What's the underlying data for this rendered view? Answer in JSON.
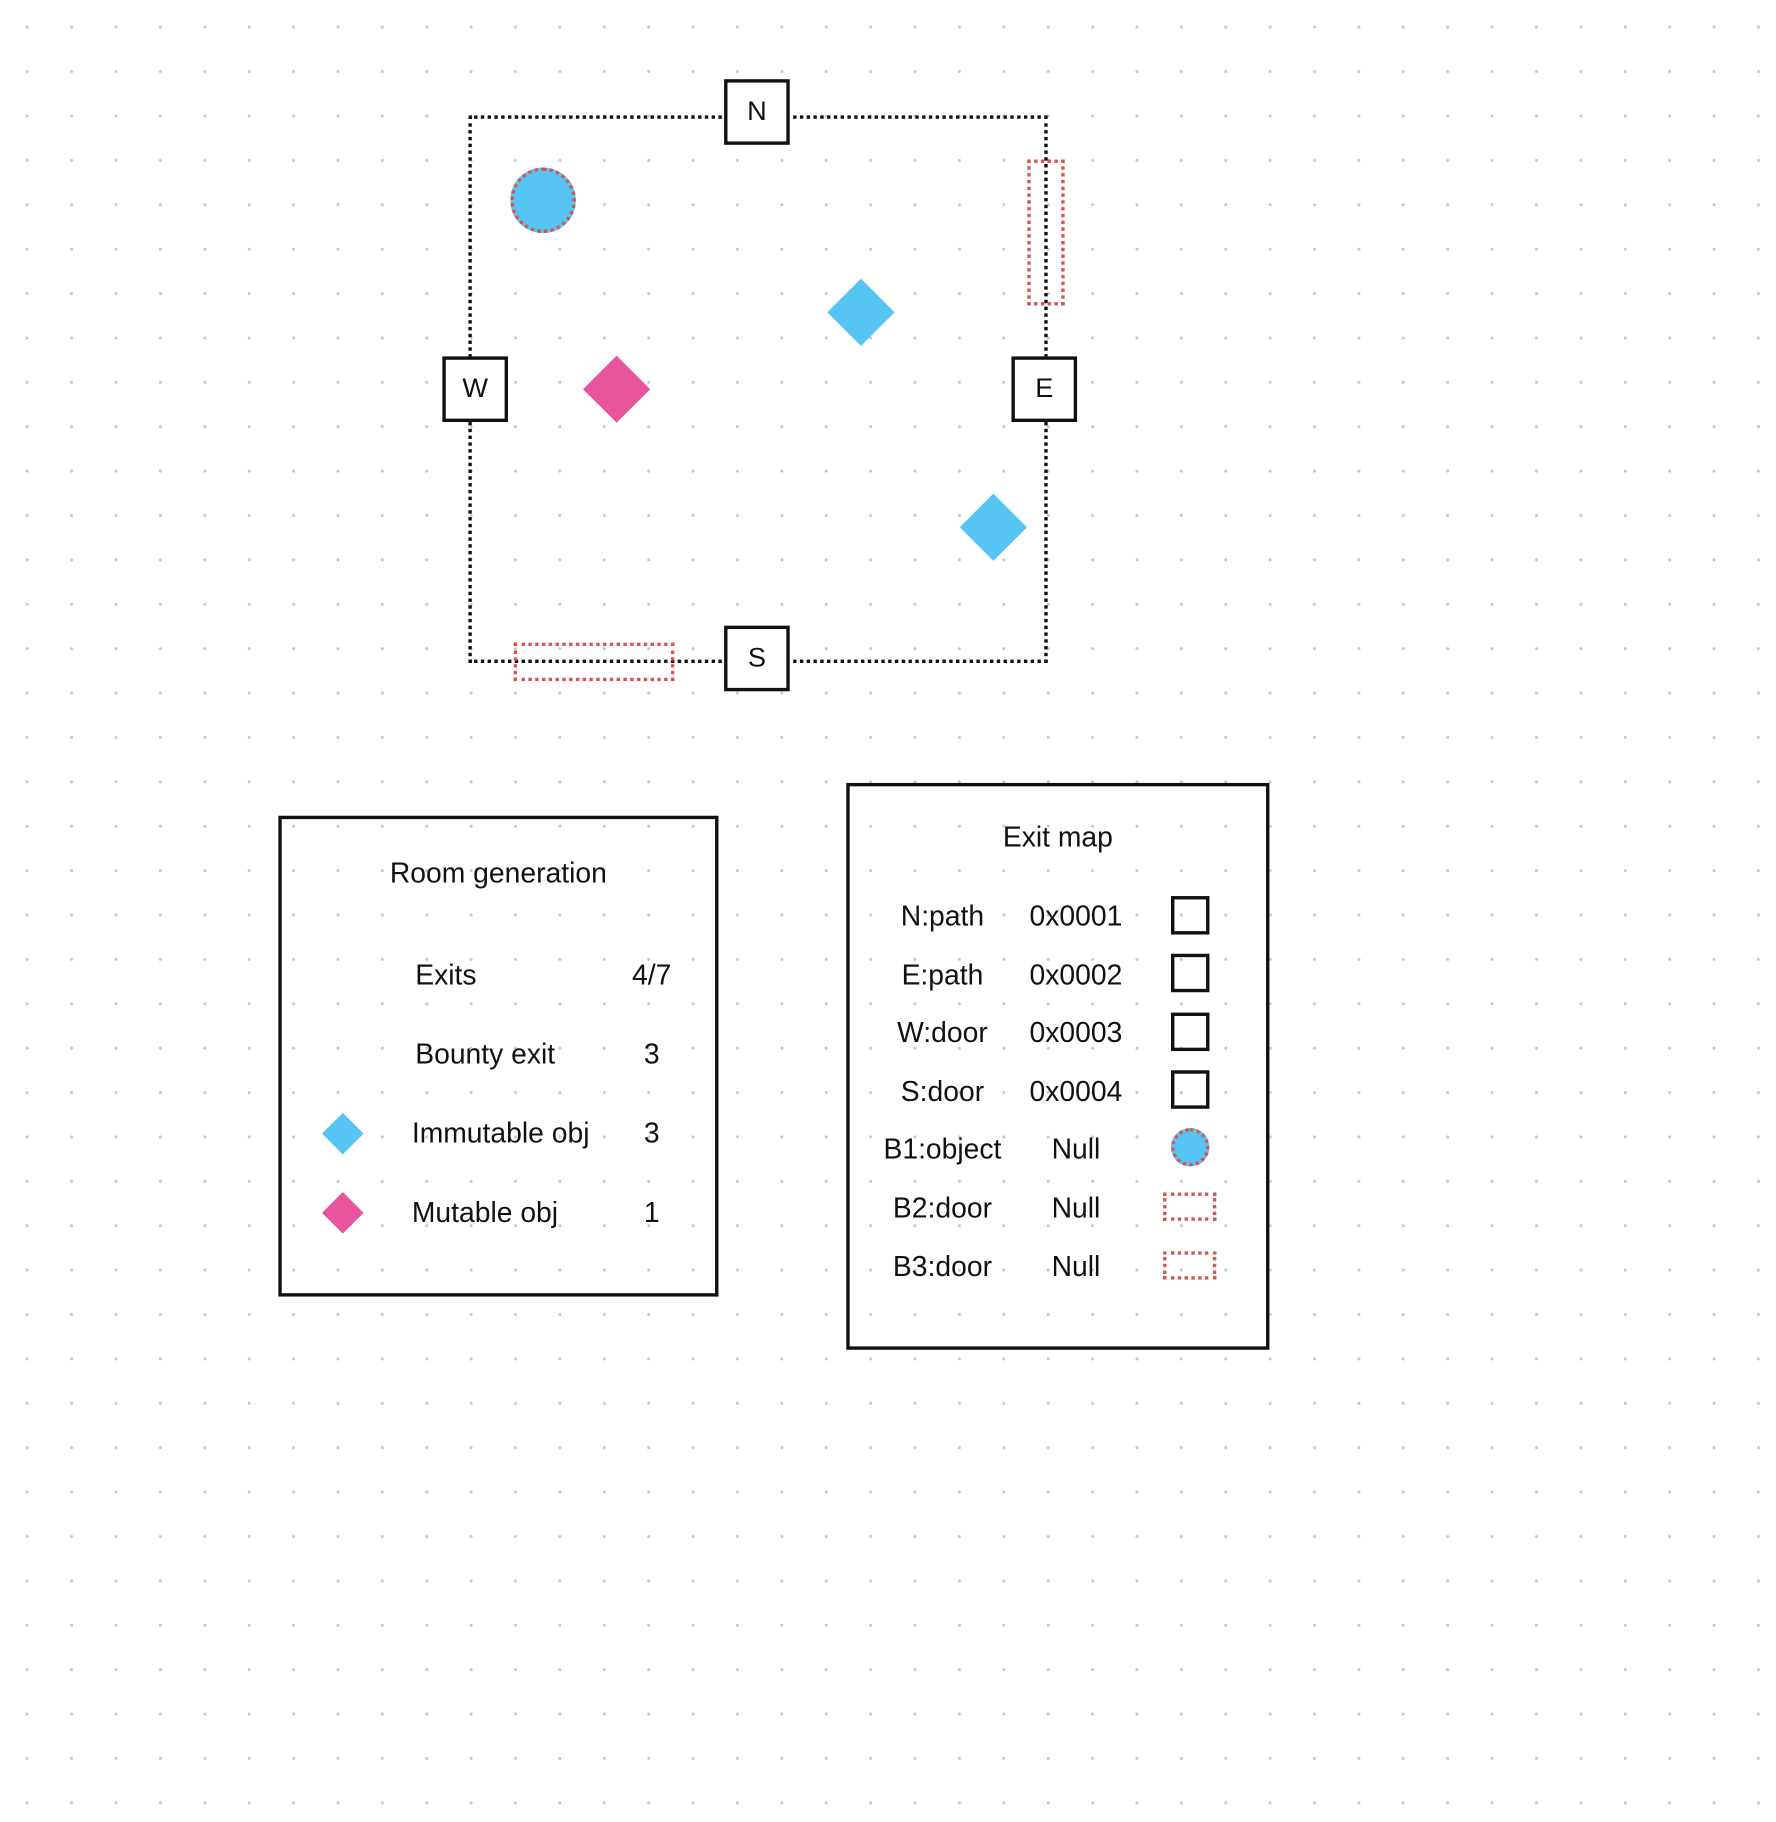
{
  "colors": {
    "immutable": "#56c5f3",
    "mutable": "#e8559e",
    "blocker": "#d9534f",
    "wall": "#111111"
  },
  "room": {
    "exits": {
      "north": "N",
      "east": "E",
      "south": "S",
      "west": "W"
    }
  },
  "room_generation": {
    "title": "Room generation",
    "rows": [
      {
        "label": "Exits",
        "value": "4/7"
      },
      {
        "label": "Bounty exit",
        "value": "3"
      },
      {
        "label": "Immutable obj",
        "value": "3",
        "icon": "blue-diamond-icon"
      },
      {
        "label": "Mutable obj",
        "value": "1",
        "icon": "pink-diamond-icon"
      }
    ]
  },
  "exit_map": {
    "title": "Exit map",
    "rows": [
      {
        "label": "N:path",
        "value": "0x0001",
        "icon": "square-icon"
      },
      {
        "label": "E:path",
        "value": "0x0002",
        "icon": "square-icon"
      },
      {
        "label": "W:door",
        "value": "0x0003",
        "icon": "square-icon"
      },
      {
        "label": "S:door",
        "value": "0x0004",
        "icon": "square-icon"
      },
      {
        "label": "B1:object",
        "value": "Null",
        "icon": "dotted-circle-icon"
      },
      {
        "label": "B2:door",
        "value": "Null",
        "icon": "dotted-door-icon"
      },
      {
        "label": "B3:door",
        "value": "Null",
        "icon": "dotted-door-icon"
      }
    ]
  }
}
